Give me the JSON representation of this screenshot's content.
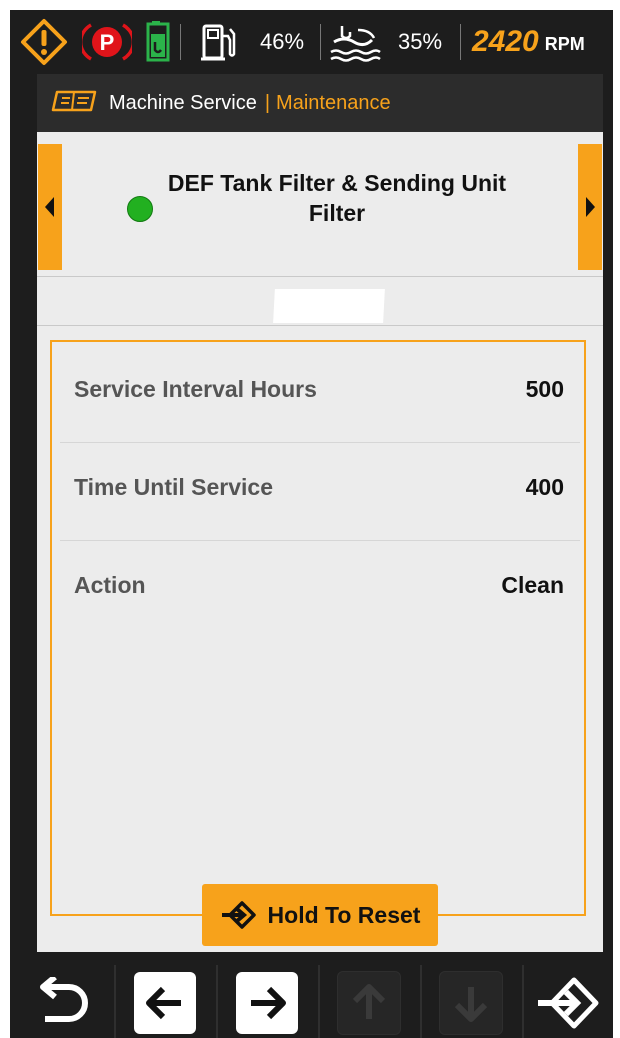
{
  "status_bar": {
    "fuel_level": "46%",
    "def_level": "35%",
    "rpm_value": "2420",
    "rpm_unit": "RPM",
    "icons": [
      "warning-icon",
      "parking-brake-icon",
      "def-tank-icon",
      "fuel-pump-icon",
      "def-fluid-icon"
    ]
  },
  "header": {
    "title": "Machine Service",
    "separator": "|",
    "subtitle": "Maintenance",
    "icon": "service-manual-icon"
  },
  "item": {
    "title": "DEF Tank Filter & Sending Unit Filter",
    "status": "ok",
    "status_color": "#22b020"
  },
  "details": {
    "rows": [
      {
        "label": "Service Interval Hours",
        "value": "500"
      },
      {
        "label": "Time Until Service",
        "value": "400"
      },
      {
        "label": "Action",
        "value": "Clean"
      }
    ]
  },
  "reset_button": {
    "label": "Hold To Reset",
    "icon": "enter-arrow-icon"
  },
  "toolbar": {
    "buttons": [
      "back-icon",
      "arrow-left-icon",
      "arrow-right-icon",
      "arrow-up-icon",
      "arrow-down-icon",
      "enter-icon"
    ]
  },
  "colors": {
    "accent": "#f7a21b",
    "background": "#1d1d1d",
    "panel": "#ececec"
  }
}
